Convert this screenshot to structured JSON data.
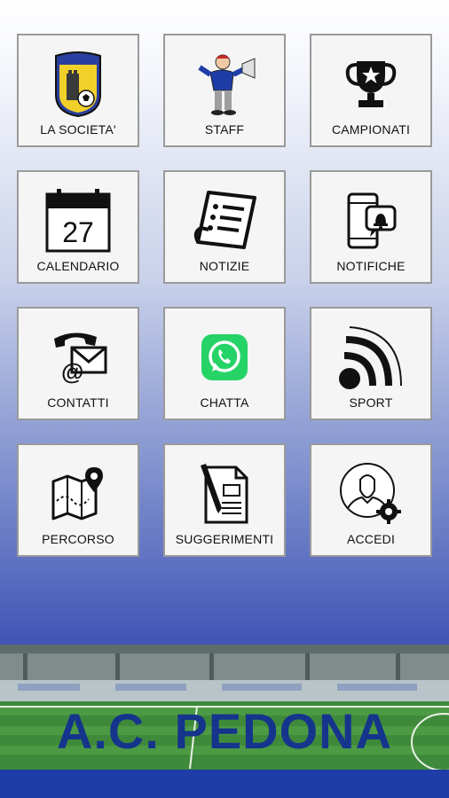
{
  "tiles": [
    {
      "label": "LA SOCIETA'",
      "icon": "club-crest-icon"
    },
    {
      "label": "STAFF",
      "icon": "coach-megaphone-icon"
    },
    {
      "label": "CAMPIONATI",
      "icon": "trophy-icon"
    },
    {
      "label": "CALENDARIO",
      "icon": "calendar-icon",
      "calendar_day": "27"
    },
    {
      "label": "NOTIZIE",
      "icon": "newspaper-icon"
    },
    {
      "label": "NOTIFICHE",
      "icon": "phone-bell-icon"
    },
    {
      "label": "CONTATTI",
      "icon": "phone-mail-icon"
    },
    {
      "label": "CHATTA",
      "icon": "whatsapp-icon"
    },
    {
      "label": "SPORT",
      "icon": "rss-icon"
    },
    {
      "label": "PERCORSO",
      "icon": "map-pin-icon"
    },
    {
      "label": "SUGGERIMENTI",
      "icon": "form-pen-icon"
    },
    {
      "label": "ACCEDI",
      "icon": "user-gear-icon"
    }
  ],
  "footer": {
    "title": "A.C. PEDONA"
  },
  "colors": {
    "title_blue": "#15358c",
    "bottom_bar": "#1f3da8",
    "whatsapp_green": "#25d366"
  }
}
